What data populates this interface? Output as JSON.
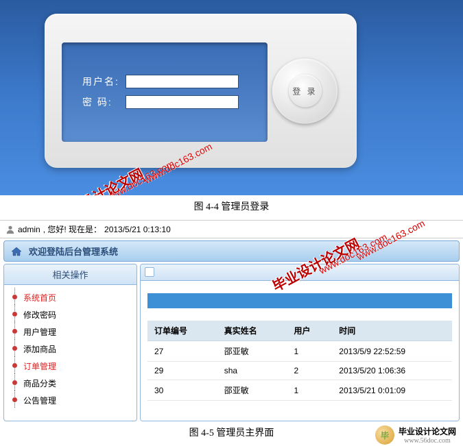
{
  "login": {
    "username_label": "用户名:",
    "password_label": "密  码:",
    "submit": "登 录"
  },
  "caption1": "图 4-4  管理员登录",
  "caption2": "图 4-5  管理员主界面",
  "status": {
    "user": "admin",
    "greeting": ", 您好! 现在是：",
    "datetime": "2013/5/21 0:13:10"
  },
  "welcome": "欢迎登陆后台管理系统",
  "sidebar": {
    "title": "相关操作",
    "items": [
      {
        "label": "系统首页",
        "active": true
      },
      {
        "label": "修改密码",
        "active": false
      },
      {
        "label": "用户管理",
        "active": false
      },
      {
        "label": "添加商品",
        "active": false
      },
      {
        "label": "订单管理",
        "active": true
      },
      {
        "label": "商品分类",
        "active": false
      },
      {
        "label": "公告管理",
        "active": false
      }
    ]
  },
  "table": {
    "headers": [
      "订单编号",
      "真实姓名",
      "用户",
      "时间"
    ],
    "rows": [
      [
        "27",
        "邵亚敏",
        "1",
        "2013/5/9 22:52:59"
      ],
      [
        "29",
        "sha",
        "2",
        "2013/5/20 1:06:36"
      ],
      [
        "30",
        "邵亚敏",
        "1",
        "2013/5/21 0:01:09"
      ]
    ]
  },
  "watermarks": {
    "big": "毕业设计论文网",
    "url": "www.doc163.com"
  },
  "footer": {
    "text": "毕业设计论文网",
    "url": "www.56doc.com"
  }
}
